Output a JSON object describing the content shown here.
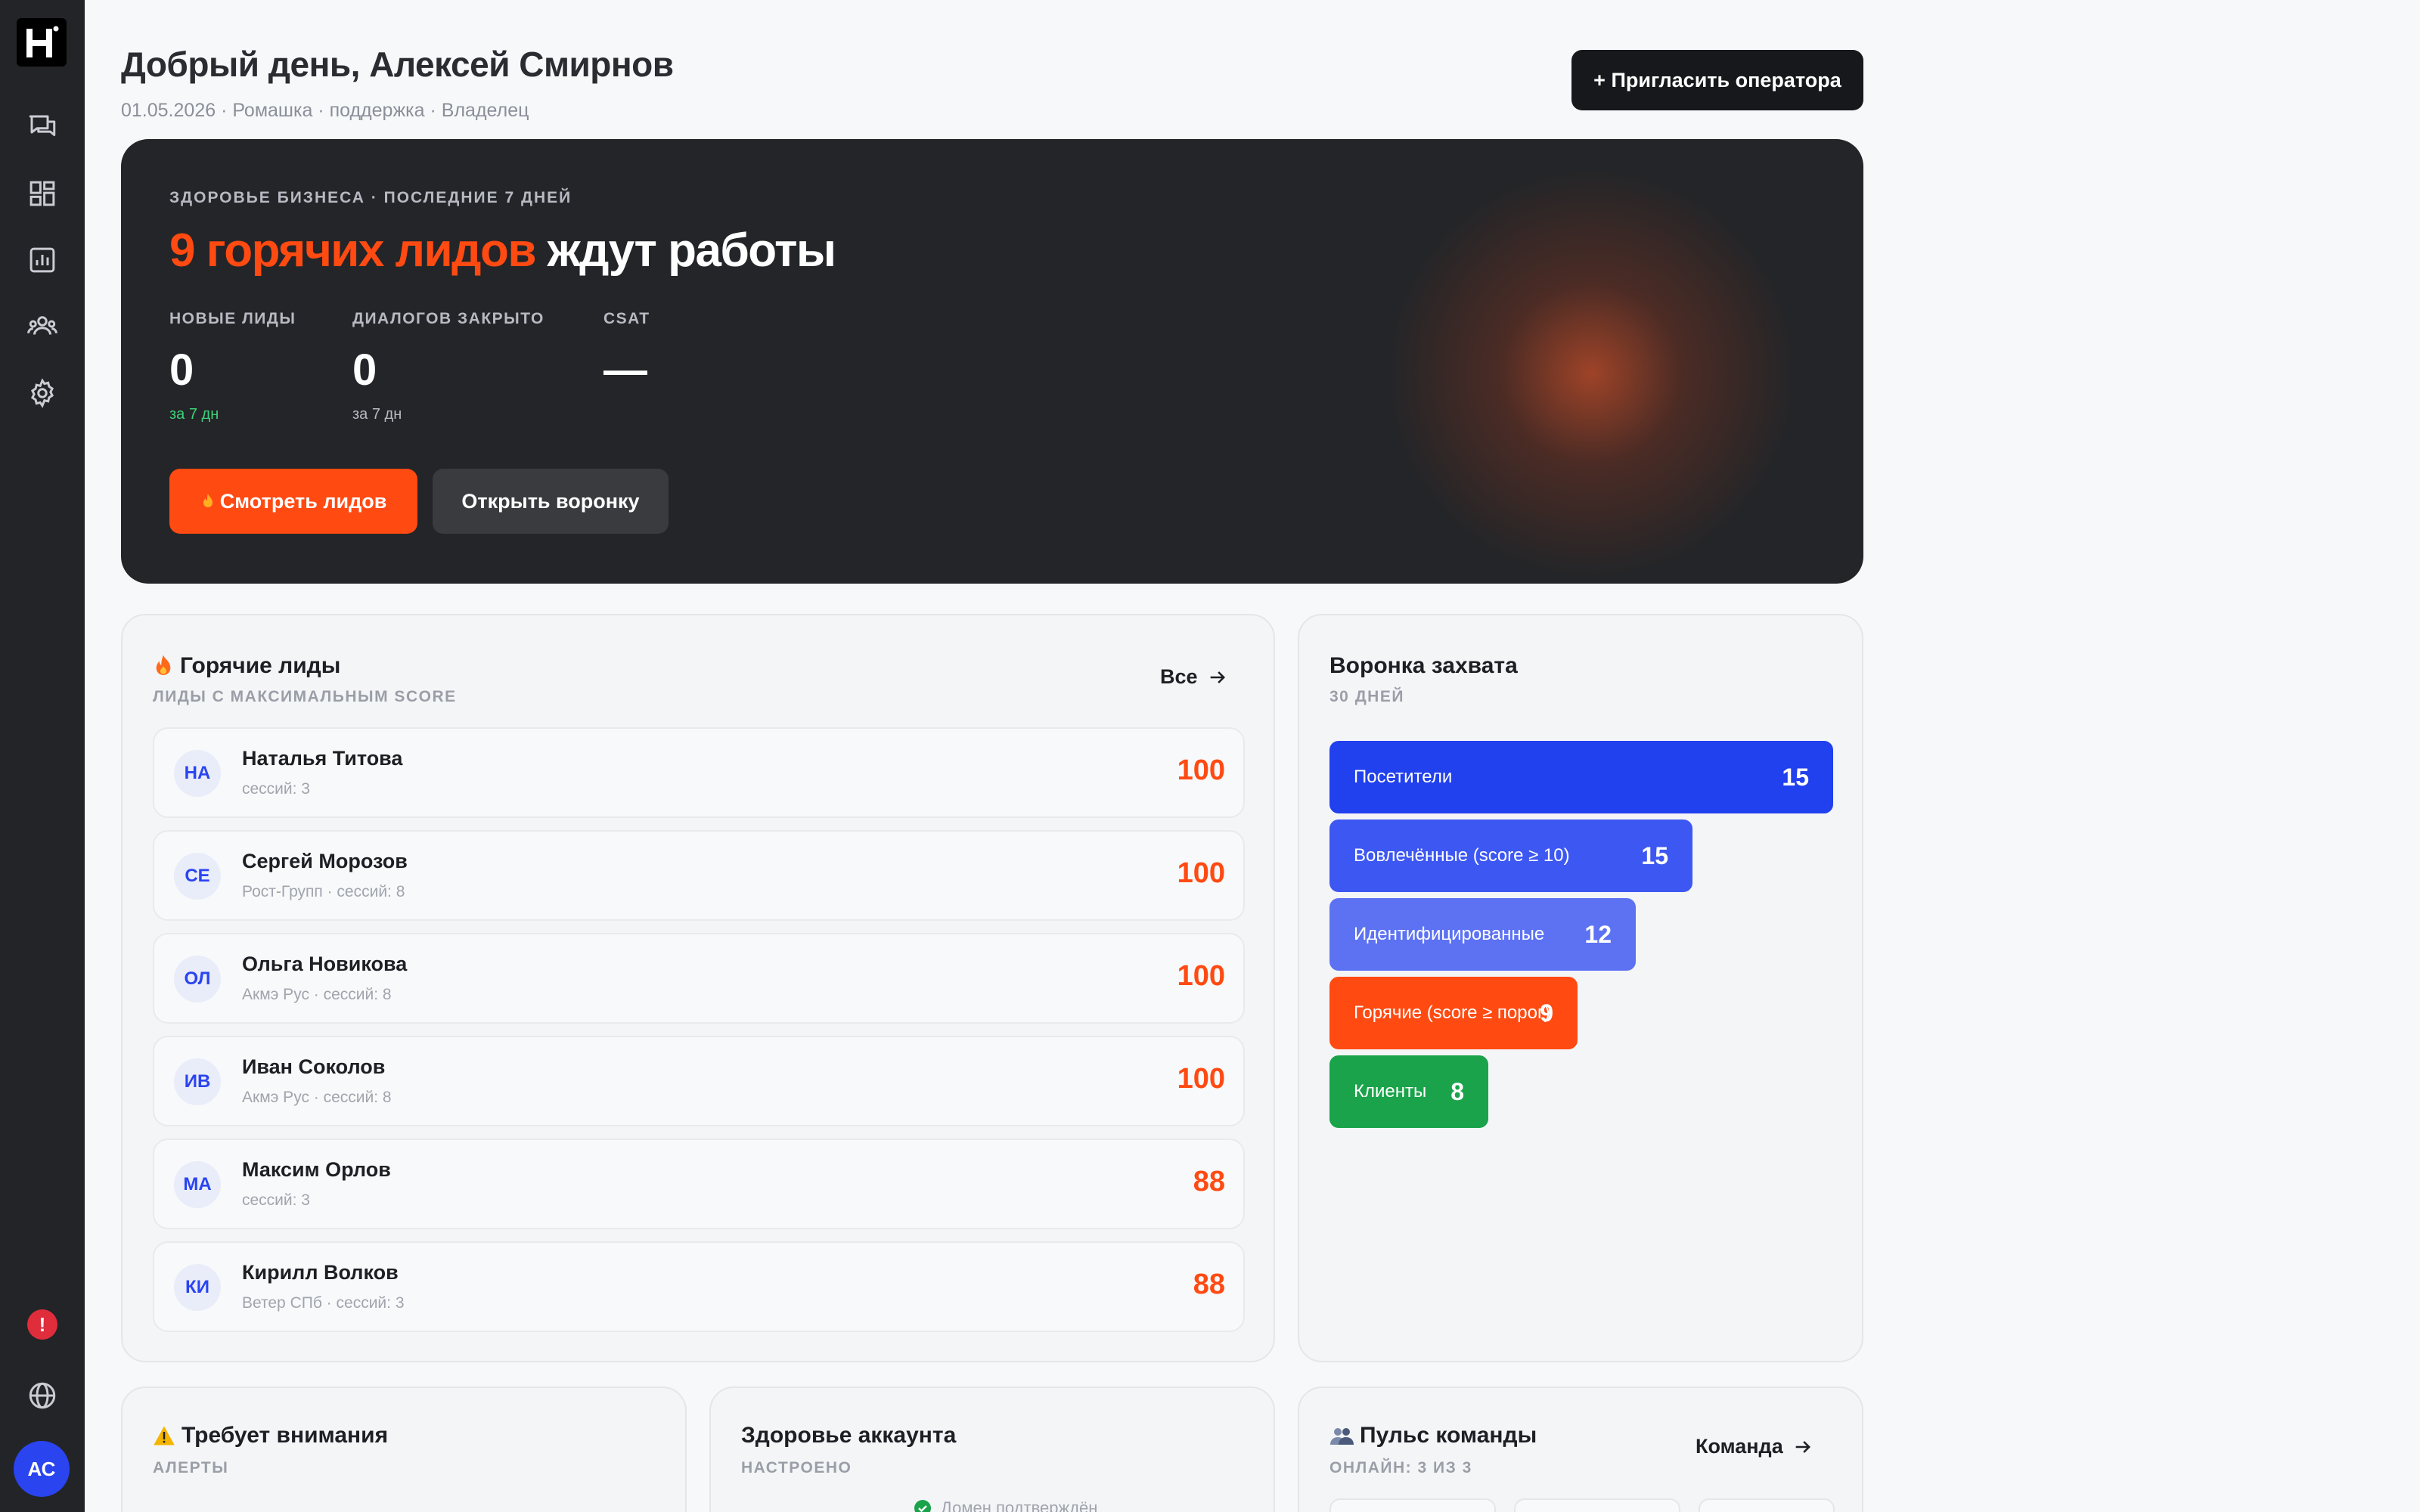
{
  "sidebar": {
    "logo": "H",
    "nav": [
      "chat-icon",
      "dashboard-icon",
      "analytics-icon",
      "team-icon",
      "settings-icon"
    ],
    "alert_badge": "!",
    "user_initials": "АС"
  },
  "header": {
    "title": "Добрый день, Алексей Смирнов",
    "subtitle": "01.05.2026 · Ромашка · поддержка · Владелец",
    "invite_button": "+ Пригласить оператора"
  },
  "hero": {
    "kicker": "ЗДОРОВЬЕ БИЗНЕСА · ПОСЛЕДНИЕ 7 ДНЕЙ",
    "title_accent": "9 горячих лидов",
    "title_rest": " ждут работы",
    "kpis": [
      {
        "label": "НОВЫЕ ЛИДЫ",
        "value": "0",
        "note": "за 7 дн"
      },
      {
        "label": "ДИАЛОГОВ ЗАКРЫТО",
        "value": "0",
        "note": "за 7 дн"
      },
      {
        "label": "CSAT",
        "value": "—",
        "note": ""
      }
    ],
    "primary_button": "Смотреть лидов",
    "secondary_button": "Открыть воронку",
    "colors": {
      "accent": "#ff4a12",
      "positive": "#3ed07a",
      "background": "#242528"
    }
  },
  "hot_leads": {
    "title": "Горячие лиды",
    "subtitle": "ЛИДЫ С МАКСИМАЛЬНЫМ SCORE",
    "link": "Все",
    "items": [
      {
        "initials": "НА",
        "name": "Наталья Титова",
        "meta": "сессий: 3",
        "score": "100"
      },
      {
        "initials": "СЕ",
        "name": "Сергей Морозов",
        "meta": "Рост-Групп · сессий: 8",
        "score": "100"
      },
      {
        "initials": "ОЛ",
        "name": "Ольга Новикова",
        "meta": "Акмэ Рус · сессий: 8",
        "score": "100"
      },
      {
        "initials": "ИВ",
        "name": "Иван Соколов",
        "meta": "Акмэ Рус · сессий: 8",
        "score": "100"
      },
      {
        "initials": "МА",
        "name": "Максим Орлов",
        "meta": "сессий: 3",
        "score": "88"
      },
      {
        "initials": "КИ",
        "name": "Кирилл Волков",
        "meta": "Ветер СПб · сессий: 3",
        "score": "88"
      }
    ]
  },
  "funnel": {
    "title": "Воронка захвата",
    "subtitle": "30 ДНЕЙ",
    "stages": [
      {
        "label": "Посетители",
        "value": 15,
        "color": "#2140ee"
      },
      {
        "label": "Вовлечённые (score ≥ 10)",
        "value": 15,
        "color": "#3d57f2"
      },
      {
        "label": "Идентифицированные",
        "value": 12,
        "color": "#5c72f3"
      },
      {
        "label": "Горячие (score ≥ порог)",
        "value": 9,
        "color": "#ff4a12"
      },
      {
        "label": "Клиенты",
        "value": 8,
        "color": "#1aa34a"
      }
    ]
  },
  "attention": {
    "title": "Требует внимания",
    "subtitle": "АЛЕРТЫ"
  },
  "account_health": {
    "title": "Здоровье аккаунта",
    "subtitle": "НАСТРОЕНО",
    "first_item": "Домен подтверждён"
  },
  "team_pulse": {
    "title": "Пульс команды",
    "subtitle": "ОНЛАЙН: 3 ИЗ 3",
    "link": "Команда"
  }
}
